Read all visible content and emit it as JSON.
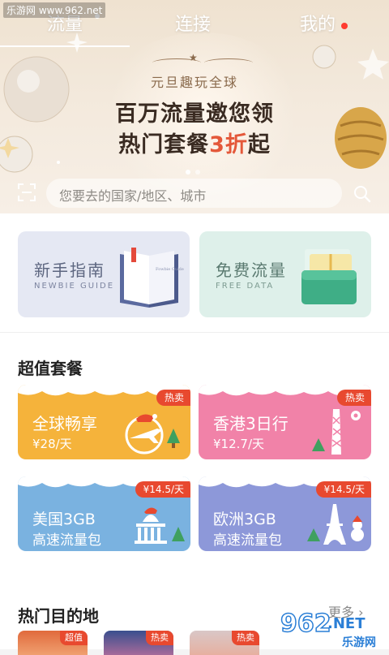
{
  "watermark": "乐游网 www.962.net",
  "tabs": [
    {
      "label": "流量",
      "active": true
    },
    {
      "label": "连接",
      "active": false
    },
    {
      "label": "我的",
      "active": false,
      "has_red_dot": true
    }
  ],
  "banner": {
    "subtitle": "元旦趣玩全球",
    "title_line1": "百万流量邀您领",
    "title_line2_prefix": "热门套餐",
    "title_line2_highlight": "3折",
    "title_line2_suffix": "起",
    "highlight_color": "#e4583a",
    "page_dots": 2,
    "active_dot": 0
  },
  "search": {
    "scan_icon": "scan-icon",
    "placeholder": "您要去的国家/地区、城市",
    "search_icon": "search-icon"
  },
  "quick_cards": [
    {
      "title": "新手指南",
      "subtitle": "NEWBIE GUIDE",
      "icon": "book-icon",
      "book_text": "Fowbie Guide"
    },
    {
      "title": "免费流量",
      "subtitle": "FREE DATA",
      "icon": "wallet-gift-icon"
    }
  ],
  "packages_section": {
    "title": "超值套餐",
    "items": [
      {
        "name": "全球畅享",
        "price": "¥28/天",
        "badge": "热卖",
        "icon": "plane-santa-hat-icon",
        "color": "#f5b33b"
      },
      {
        "name": "香港3日行",
        "price": "¥12.7/天",
        "badge": "热卖",
        "icon": "hongkong-tower-icon",
        "color": "#f182a8"
      },
      {
        "name": "美国3GB",
        "sub": "高速流量包",
        "badge": "¥14.5/天",
        "icon": "capitol-building-icon",
        "color": "#7ab2e0"
      },
      {
        "name": "欧洲3GB",
        "sub": "高速流量包",
        "badge": "¥14.5/天",
        "icon": "eiffel-tower-icon",
        "color": "#8d98d9"
      }
    ]
  },
  "destinations_section": {
    "title": "热门目的地",
    "more": "更多",
    "items": [
      {
        "badge": "超值"
      },
      {
        "badge": "热卖"
      },
      {
        "badge": "热卖"
      }
    ]
  },
  "site_logo": {
    "text": "962",
    "suffix": ".NET",
    "sub": "乐游网"
  }
}
